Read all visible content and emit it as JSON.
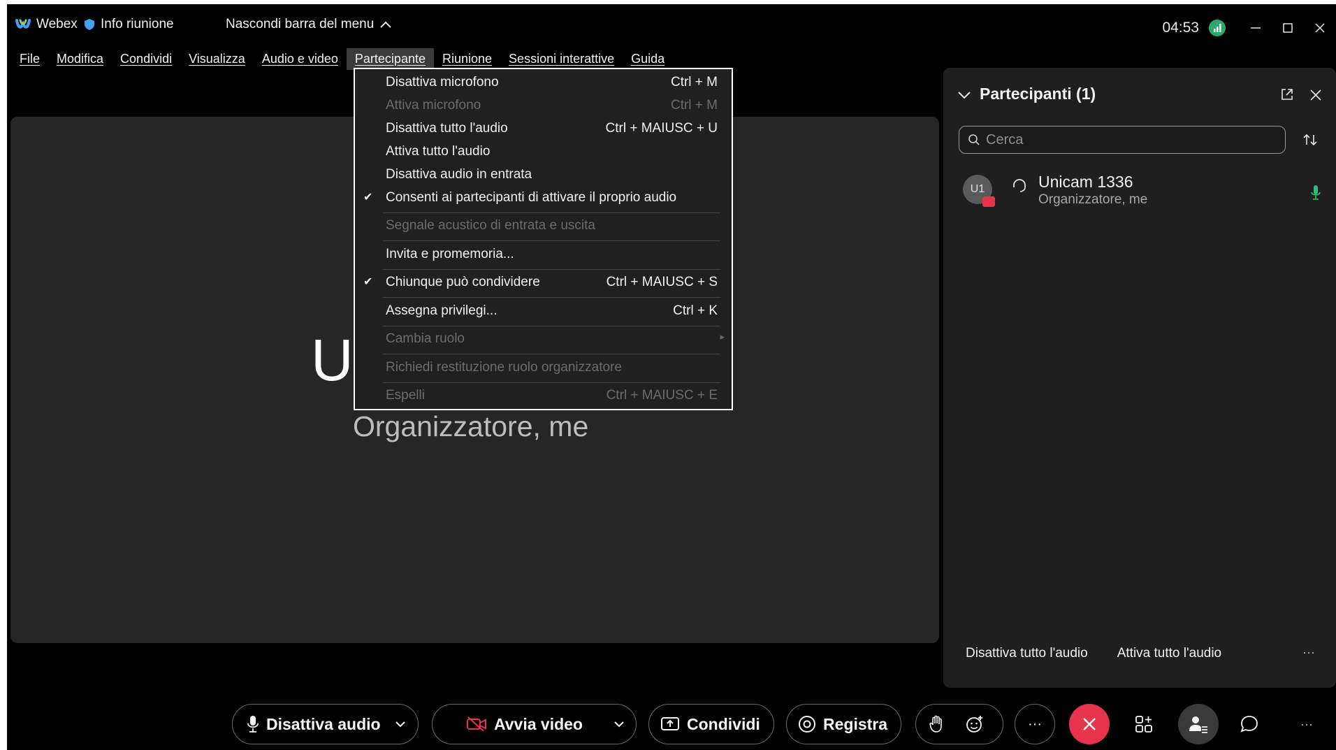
{
  "titlebar": {
    "app_name": "Webex",
    "meeting_info": "Info riunione",
    "hide_menu": "Nascondi barra del menu",
    "time": "04:53"
  },
  "menubar": {
    "items": [
      "File",
      "Modifica",
      "Condividi",
      "Visualizza",
      "Audio e video",
      "Partecipante",
      "Riunione",
      "Sessioni interattive",
      "Guida"
    ],
    "active": "Partecipante"
  },
  "stage": {
    "name_partial": "U",
    "role": "Organizzatore, me"
  },
  "participant_menu": [
    {
      "label": "Disattiva microfono",
      "shortcut": "Ctrl + M",
      "enabled": true,
      "checked": false
    },
    {
      "label": "Attiva microfono",
      "shortcut": "Ctrl + M",
      "enabled": false,
      "checked": false
    },
    {
      "label": "Disattiva tutto l'audio",
      "shortcut": "Ctrl + MAIUSC + U",
      "enabled": true,
      "checked": false
    },
    {
      "label": "Attiva tutto l'audio",
      "shortcut": "",
      "enabled": true,
      "checked": false
    },
    {
      "label": "Disattiva audio in entrata",
      "shortcut": "",
      "enabled": true,
      "checked": false
    },
    {
      "label": "Consenti ai partecipanti di attivare il proprio audio",
      "shortcut": "",
      "enabled": true,
      "checked": true
    },
    {
      "label": "Segnale acustico di entrata e uscita",
      "shortcut": "",
      "enabled": false,
      "checked": false
    },
    {
      "label": "Invita e promemoria...",
      "shortcut": "",
      "enabled": true,
      "checked": false
    },
    {
      "label": "Chiunque può condividere",
      "shortcut": "Ctrl + MAIUSC + S",
      "enabled": true,
      "checked": true
    },
    {
      "label": "Assegna privilegi...",
      "shortcut": "Ctrl + K",
      "enabled": true,
      "checked": false
    },
    {
      "label": "Cambia ruolo",
      "shortcut": "",
      "enabled": false,
      "checked": false,
      "submenu": true
    },
    {
      "label": "Richiedi restituzione ruolo organizzatore",
      "shortcut": "",
      "enabled": false,
      "checked": false
    },
    {
      "label": "Espelli",
      "shortcut": "Ctrl + MAIUSC + E",
      "enabled": false,
      "checked": false
    }
  ],
  "panel": {
    "title": "Partecipanti (1)",
    "search_placeholder": "Cerca",
    "participant": {
      "initials": "U1",
      "name": "Unicam 1336",
      "role": "Organizzatore, me"
    },
    "mute_all": "Disattiva tutto l'audio",
    "unmute_all": "Attiva tutto l'audio",
    "more": "···"
  },
  "controls": {
    "mute": "Disattiva audio",
    "video": "Avvia video",
    "share": "Condividi",
    "record": "Registra",
    "more": "···",
    "overflow": "···"
  },
  "colors": {
    "background": "#000000",
    "stage": "#262626",
    "panel": "#1f1f1f",
    "end_call": "#e5344b",
    "mic_active": "#2fbf71",
    "signal": "#2fa86b"
  }
}
